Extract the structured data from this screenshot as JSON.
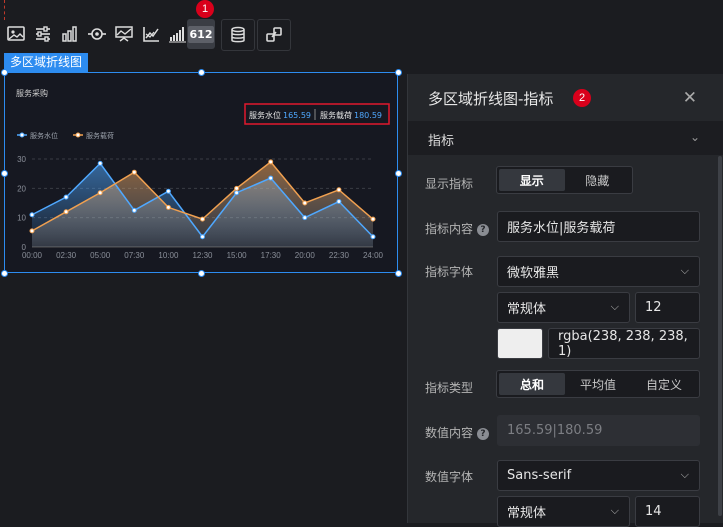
{
  "toolbar": {
    "icons": [
      "image-icon",
      "sliders-icon",
      "bar-chart-icon",
      "eye-target-icon",
      "line-area-icon",
      "trend-icon",
      "ascending-bar-icon",
      "metric-number-icon",
      "database-icon",
      "link-icon"
    ],
    "metric_icon_text": "612",
    "badge_1": "1"
  },
  "component": {
    "label": "多区域折线图"
  },
  "chart": {
    "title": "服务采购",
    "metric": {
      "name1": "服务水位",
      "value1": "165.59",
      "name2": "服务载荷",
      "value2": "180.59"
    },
    "legend": [
      "服务水位",
      "服务载荷"
    ]
  },
  "chart_data": {
    "type": "area",
    "title": "服务采购",
    "x": [
      "00:00",
      "02:30",
      "05:00",
      "07:30",
      "10:00",
      "12:30",
      "15:00",
      "17:30",
      "20:00",
      "22:30",
      "24:00"
    ],
    "ylim": [
      0,
      30
    ],
    "yticks": [
      "0",
      "10",
      "20",
      "30"
    ],
    "grid": true,
    "legend_position": "top-left",
    "series": [
      {
        "name": "服务水位",
        "color": "#4fa8ff",
        "values": [
          11,
          17,
          28.5,
          12.5,
          19,
          3.5,
          18.5,
          23.5,
          10,
          15.5,
          3.5
        ]
      },
      {
        "name": "服务载荷",
        "color": "#f0a050",
        "values": [
          5.5,
          12,
          18.5,
          25.5,
          13.5,
          9.5,
          20,
          29,
          15,
          19.5,
          9.5
        ]
      }
    ]
  },
  "panel": {
    "title": "多区域折线图-指标",
    "badge_2": "2",
    "close": "✕",
    "section": "指标",
    "section_chevron": "⌄",
    "show_label": "显示指标",
    "show_options": [
      "显示",
      "隐藏"
    ],
    "content_label": "指标内容",
    "content_value": "服务水位|服务载荷",
    "font_label": "指标字体",
    "font_value": "微软雅黑",
    "style_value": "常规体",
    "size_value": "12",
    "color_value": "rgba(238, 238, 238, 1)",
    "type_label": "指标类型",
    "type_options": [
      "总和",
      "平均值",
      "自定义"
    ],
    "num_content_label": "数值内容",
    "num_content_value": "165.59|180.59",
    "num_font_label": "数值字体",
    "num_font_value": "Sans-serif",
    "num_style_value": "常规体",
    "num_size_value": "14",
    "chevron": "⌵"
  }
}
